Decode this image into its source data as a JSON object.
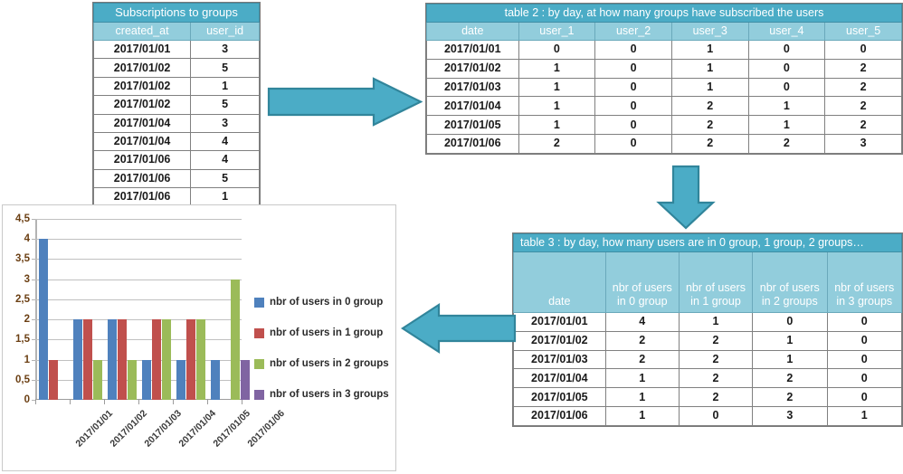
{
  "table1": {
    "title": "Subscriptions to groups",
    "columns": [
      "created_at",
      "user_id"
    ],
    "rows": [
      [
        "2017/01/01",
        "3"
      ],
      [
        "2017/01/02",
        "5"
      ],
      [
        "2017/01/02",
        "1"
      ],
      [
        "2017/01/02",
        "5"
      ],
      [
        "2017/01/04",
        "3"
      ],
      [
        "2017/01/04",
        "4"
      ],
      [
        "2017/01/06",
        "4"
      ],
      [
        "2017/01/06",
        "5"
      ],
      [
        "2017/01/06",
        "1"
      ]
    ]
  },
  "table2": {
    "title": "table 2 : by day, at how many groups have subscribed the users",
    "columns": [
      "date",
      "user_1",
      "user_2",
      "user_3",
      "user_4",
      "user_5"
    ],
    "rows": [
      [
        "2017/01/01",
        "0",
        "0",
        "1",
        "0",
        "0"
      ],
      [
        "2017/01/02",
        "1",
        "0",
        "1",
        "0",
        "2"
      ],
      [
        "2017/01/03",
        "1",
        "0",
        "1",
        "0",
        "2"
      ],
      [
        "2017/01/04",
        "1",
        "0",
        "2",
        "1",
        "2"
      ],
      [
        "2017/01/05",
        "1",
        "0",
        "2",
        "1",
        "2"
      ],
      [
        "2017/01/06",
        "2",
        "0",
        "2",
        "2",
        "3"
      ]
    ]
  },
  "table3": {
    "title": "table 3 : by day, how many users are in 0 group, 1 group, 2 groups…",
    "columns": [
      "date",
      "nbr of users in 0 group",
      "nbr of users in 1 group",
      "nbr of users in 2 groups",
      "nbr of users in 3 groups"
    ],
    "rows": [
      [
        "2017/01/01",
        "4",
        "1",
        "0",
        "0"
      ],
      [
        "2017/01/02",
        "2",
        "2",
        "1",
        "0"
      ],
      [
        "2017/01/03",
        "2",
        "2",
        "1",
        "0"
      ],
      [
        "2017/01/04",
        "1",
        "2",
        "2",
        "0"
      ],
      [
        "2017/01/05",
        "1",
        "2",
        "2",
        "0"
      ],
      [
        "2017/01/06",
        "1",
        "0",
        "3",
        "1"
      ]
    ]
  },
  "arrows": {
    "right_label": "arrow from table 1 to table 2",
    "down_label": "arrow from table 2 to table 3",
    "left_label": "arrow from table 3 to chart",
    "fill": "#4BACC6",
    "stroke": "#31859B"
  },
  "chart_data": {
    "type": "bar",
    "title": "",
    "xlabel": "",
    "ylabel": "",
    "categories": [
      "2017/01/01",
      "2017/01/02",
      "2017/01/03",
      "2017/01/04",
      "2017/01/05",
      "2017/01/06"
    ],
    "series": [
      {
        "name": "nbr of users in 0 group",
        "color": "#4F81BD",
        "values": [
          4,
          2,
          2,
          1,
          1,
          1
        ]
      },
      {
        "name": "nbr of users in 1 group",
        "color": "#C0504D",
        "values": [
          1,
          2,
          2,
          2,
          2,
          0
        ]
      },
      {
        "name": "nbr of users in 2 groups",
        "color": "#9BBB59",
        "values": [
          0,
          1,
          1,
          2,
          2,
          3
        ]
      },
      {
        "name": "nbr of users in 3 groups",
        "color": "#8064A2",
        "values": [
          0,
          0,
          0,
          0,
          0,
          1
        ]
      }
    ],
    "ylim": [
      0,
      4.5
    ],
    "yticks": [
      0,
      0.5,
      1,
      1.5,
      2,
      2.5,
      3,
      3.5,
      4,
      4.5
    ],
    "ytick_labels": [
      "0",
      "0,5",
      "1",
      "1,5",
      "2",
      "2,5",
      "3",
      "3,5",
      "4",
      "4,5"
    ],
    "grid": true,
    "legend_position": "right"
  }
}
